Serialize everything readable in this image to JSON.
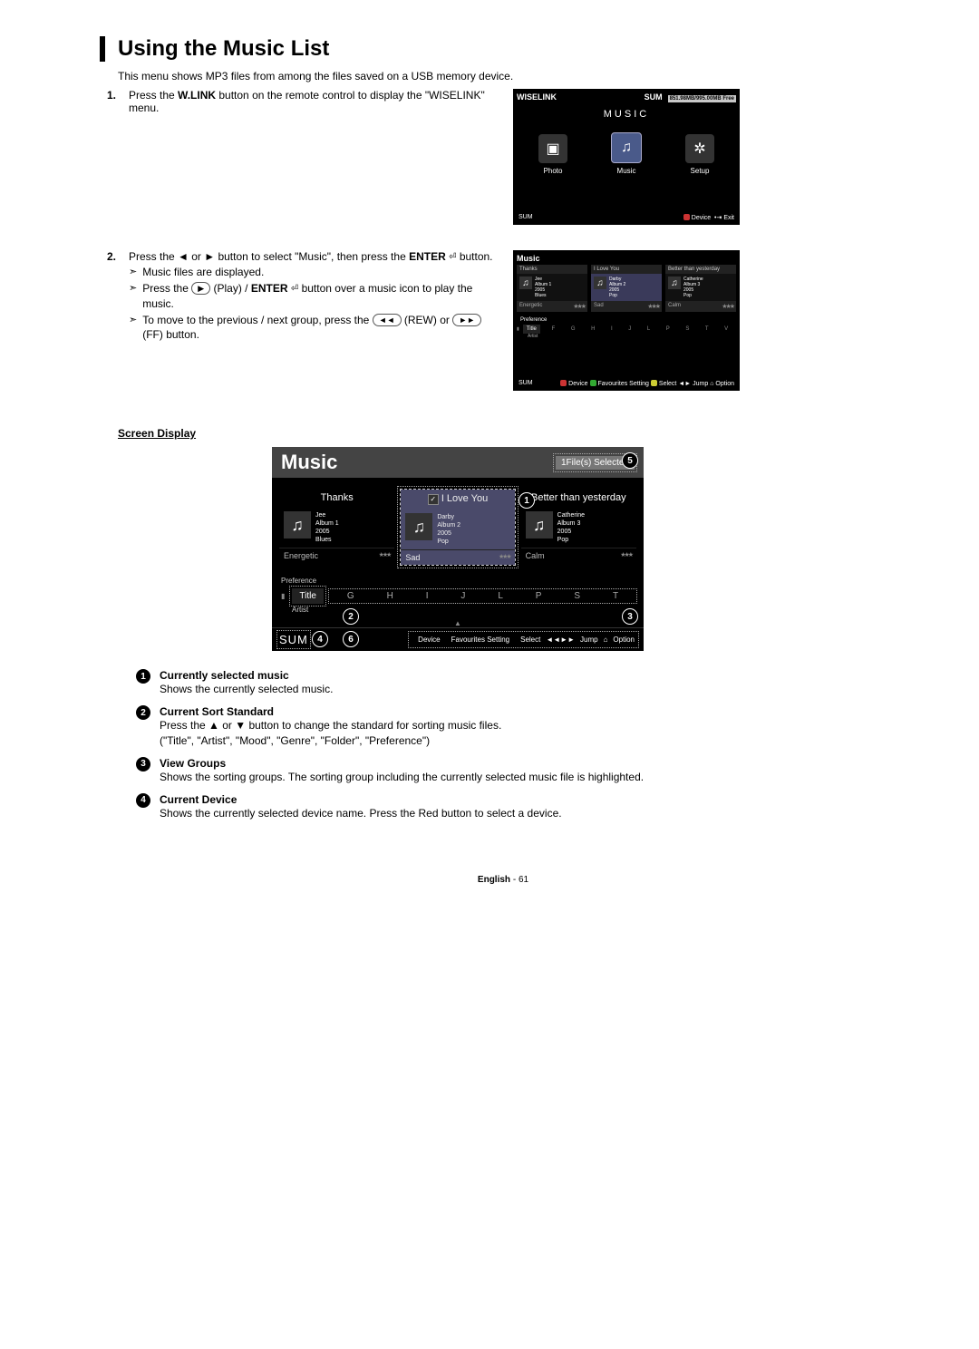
{
  "title": "Using the Music List",
  "intro": "This menu shows MP3 files from among the files saved on a USB memory device.",
  "steps": {
    "s1": {
      "num": "1.",
      "text_a": "Press the ",
      "bold1": "W.LINK",
      "text_b": " button on the remote control to display the \"WISELINK\" menu."
    },
    "s2": {
      "num": "2.",
      "text_a": "Press the ◄ or ► button to select \"Music\", then press the ",
      "bold1": "ENTER",
      "enter_sym": "⏎",
      "text_b": " button.",
      "b1": "Music files are displayed.",
      "b2_a": "Press the ",
      "b2_play": "▶",
      "b2_b": " (Play) / ",
      "b2_bold": "ENTER",
      "b2_c": " button over a music icon to play the music.",
      "b3_a": "To move to the previous / next group, press the ",
      "b3_rew": "◄◄",
      "b3_b": " (REW) or ",
      "b3_ff": "►►",
      "b3_c": " (FF) button."
    }
  },
  "fig1": {
    "title": "WISELINK",
    "memory": "851.98MB/995.00MB Free",
    "sum": "SUM",
    "big_label": "MUSIC",
    "icons": {
      "photo": "Photo",
      "music": "Music",
      "setup": "Setup"
    },
    "footer": {
      "device": "Device",
      "exit": "Exit"
    }
  },
  "fig2": {
    "title": "Music",
    "cards": [
      {
        "title": "Thanks",
        "artist": "Jee",
        "album": "Album 1",
        "year": "2005",
        "genre": "Blues",
        "mood": "Energetic"
      },
      {
        "title": "I Love You",
        "artist": "Darby",
        "album": "Album 2",
        "year": "2005",
        "genre": "Pop",
        "mood": "Sad"
      },
      {
        "title": "Better than yesterday",
        "artist": "Catherine",
        "album": "Album 3",
        "year": "2005",
        "genre": "Pop",
        "mood": "Calm"
      }
    ],
    "pref": "Preference",
    "sort_title": "Title",
    "sort_artist": "Artist",
    "letters": [
      "F",
      "G",
      "H",
      "I",
      "J",
      "L",
      "P",
      "S",
      "T",
      "V"
    ],
    "footer": {
      "sum": "SUM",
      "device": "Device",
      "fav": "Favourites Setting",
      "select": "Select",
      "jump": "Jump",
      "option": "Option"
    }
  },
  "screen_display_heading": "Screen Display",
  "big": {
    "title": "Music",
    "selected_files": "1File(s) Selected",
    "cards": [
      {
        "title": "Thanks",
        "artist": "Jee",
        "album": "Album 1",
        "year": "2005",
        "genre": "Blues",
        "mood": "Energetic"
      },
      {
        "title": "I Love You",
        "artist": "Darby",
        "album": "Album 2",
        "year": "2005",
        "genre": "Pop",
        "mood": "Sad"
      },
      {
        "title": "Better than yesterday",
        "artist": "Catherine",
        "album": "Album 3",
        "year": "2005",
        "genre": "Pop",
        "mood": "Calm"
      }
    ],
    "pref": "Preference",
    "sort_title": "Title",
    "sort_artist": "Artist",
    "letters": [
      "G",
      "H",
      "I",
      "J",
      "L",
      "P",
      "S",
      "T"
    ],
    "footer": {
      "sum": "SUM",
      "device": "Device",
      "fav": "Favourites Setting",
      "select": "Select",
      "jump": "Jump",
      "option": "Option"
    }
  },
  "callouts": {
    "c1": {
      "num": "1",
      "title": "Currently selected music",
      "desc": "Shows the currently selected music."
    },
    "c2": {
      "num": "2",
      "title": "Current Sort Standard",
      "desc": "Press the ▲ or ▼ button to change the standard for sorting music files.\n(\"Title\", \"Artist\", \"Mood\", \"Genre\", \"Folder\", \"Preference\")"
    },
    "c3": {
      "num": "3",
      "title": "View Groups",
      "desc": "Shows the sorting groups. The sorting group including the currently selected music file is highlighted."
    },
    "c4": {
      "num": "4",
      "title": "Current Device",
      "desc": "Shows the currently selected device name. Press the Red button to select a device."
    }
  },
  "page": {
    "lang": "English",
    "num": "61"
  },
  "stars": "★ ★ ★"
}
